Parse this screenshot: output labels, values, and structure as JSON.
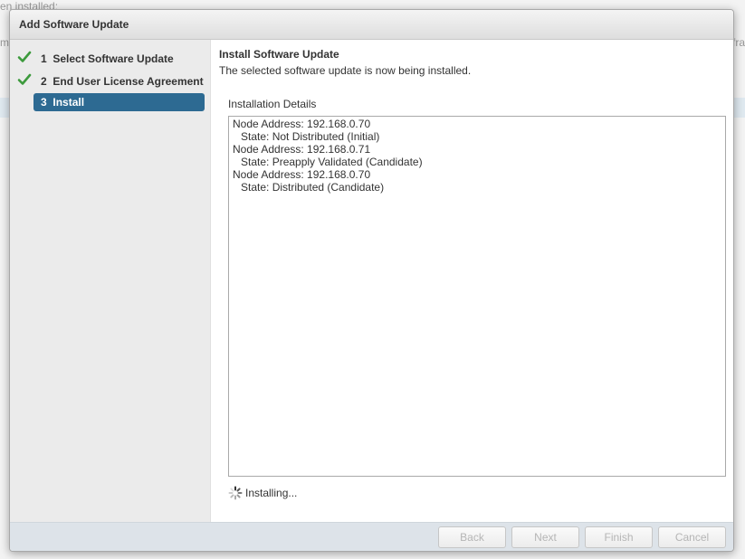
{
  "background": {
    "top_text": "en installed:",
    "left_text": "ma",
    "right_text": "fra"
  },
  "dialog": {
    "title": "Add Software Update",
    "steps": [
      {
        "number": "1",
        "label": "Select Software Update",
        "status": "complete"
      },
      {
        "number": "2",
        "label": "End User License Agreement",
        "status": "complete"
      },
      {
        "number": "3",
        "label": "Install",
        "status": "active"
      }
    ],
    "content": {
      "title": "Install Software Update",
      "description": "The selected software update is now being installed.",
      "details_label": "Installation Details",
      "details": [
        "Node Address: 192.168.0.70",
        "State: Not Distributed (Initial)",
        "Node Address: 192.168.0.71",
        "State: Preapply Validated (Candidate)",
        "Node Address: 192.168.0.70",
        "State: Distributed (Candidate)"
      ],
      "status_text": "Installing..."
    },
    "buttons": {
      "back": "Back",
      "next": "Next",
      "finish": "Finish",
      "cancel": "Cancel"
    }
  },
  "colors": {
    "accent": "#2d6a92",
    "check": "#3c9a3c",
    "disabled_text": "#b5b5b5"
  }
}
